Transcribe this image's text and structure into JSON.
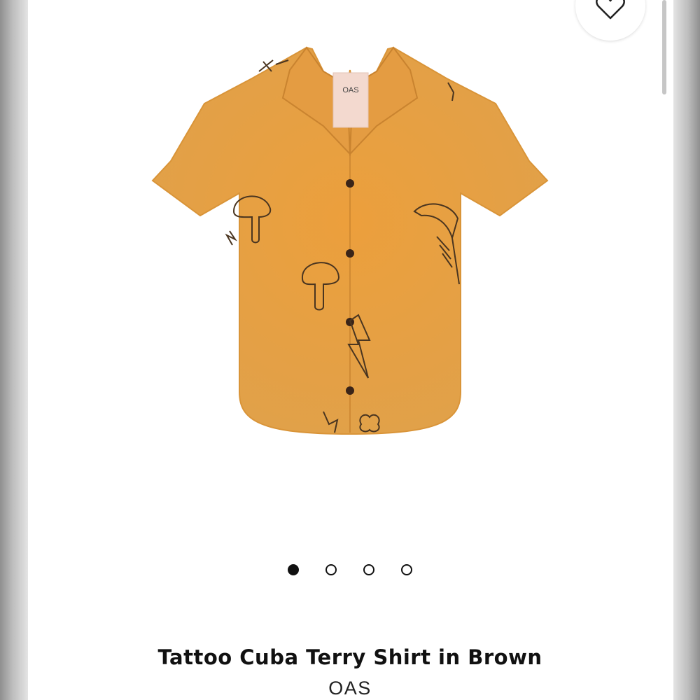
{
  "product": {
    "title": "Tattoo Cuba Terry Shirt in Brown",
    "brand": "OAS",
    "label_text": "OAS"
  },
  "gallery": {
    "image_count": 4,
    "active_index": 0
  },
  "icons": {
    "wishlist": "heart-icon"
  },
  "colors": {
    "shirt": "#e4a24a",
    "shirt_shadow": "#cf8a35",
    "stitch": "#4a3520",
    "button": "#3a2418",
    "text": "#111111"
  }
}
